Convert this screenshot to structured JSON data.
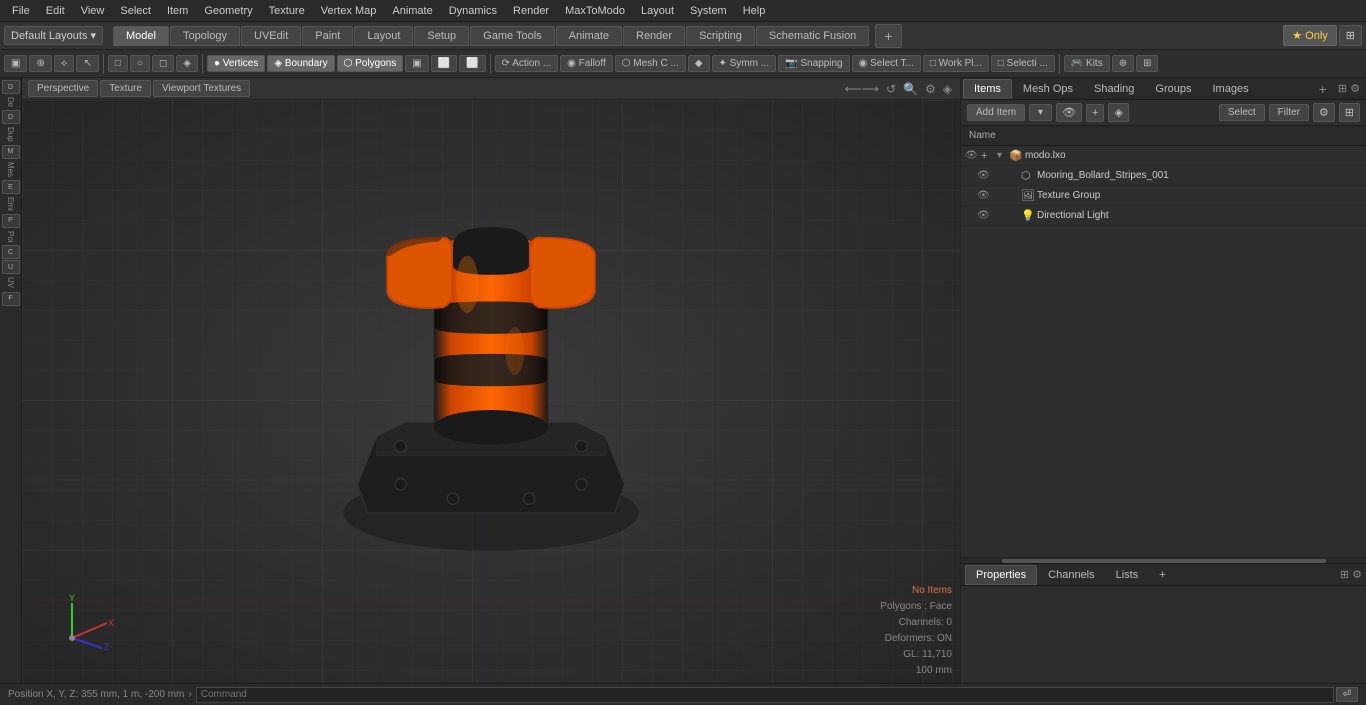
{
  "menubar": {
    "items": [
      "File",
      "Edit",
      "View",
      "Select",
      "Item",
      "Geometry",
      "Texture",
      "Vertex Map",
      "Animate",
      "Dynamics",
      "Render",
      "MaxToModo",
      "Layout",
      "System",
      "Help"
    ]
  },
  "layout_bar": {
    "default_layout": "Default Layouts ▾",
    "tabs": [
      "Model",
      "Topology",
      "UVEdit",
      "Paint",
      "Layout",
      "Setup",
      "Game Tools",
      "Animate",
      "Render",
      "Scripting",
      "Schematic Fusion"
    ],
    "active_tab": "Model",
    "plus": "+",
    "star_label": "★ Only",
    "expand_label": "⊞"
  },
  "toolbar": {
    "items": [
      "▣",
      "⊕",
      "⟡",
      "↖",
      "□",
      "○",
      "◻",
      "◈",
      "● Vertices",
      "◈ Boundary",
      "⬡ Polygons",
      "▣",
      "⬜",
      "⬜",
      "⟳ Action ...",
      "◉ Falloff",
      "⬡ Mesh C ...",
      "◆",
      "✦ Symm ...",
      "📷 Snapping",
      "◉ Select T...",
      "□ Work Pl...",
      "□ Selecti ...",
      "🎮 Kits",
      "⊕",
      "⊞"
    ]
  },
  "viewport": {
    "tabs": [
      "Perspective",
      "Texture",
      "Viewport Textures"
    ],
    "active_tab": "Perspective",
    "status": {
      "no_items": "No Items",
      "polygons": "Polygons : Face",
      "channels": "Channels: 0",
      "deformers": "Deformers: ON",
      "gl": "GL: 11,710",
      "units": "100 mm"
    }
  },
  "position_bar": {
    "text": "Position X, Y, Z:   355 mm, 1 m, -200 mm"
  },
  "right_panel": {
    "tabs": [
      "Items",
      "Mesh Ops",
      "Shading",
      "Groups",
      "Images"
    ],
    "active_tab": "Items",
    "add_item_label": "Add Item",
    "add_item_dropdown": "▾",
    "filter_label": "Filter",
    "select_label": "Select",
    "col_header": "Name",
    "items_list": [
      {
        "id": 0,
        "label": "modo.lxo",
        "icon": "📦",
        "indent": 0,
        "expanded": true,
        "eye": true
      },
      {
        "id": 1,
        "label": "Mooring_Bollard_Stripes_001",
        "icon": "⬡",
        "indent": 1,
        "eye": true
      },
      {
        "id": 2,
        "label": "Texture Group",
        "icon": "🖼",
        "indent": 1,
        "eye": true
      },
      {
        "id": 3,
        "label": "Directional Light",
        "icon": "💡",
        "indent": 1,
        "eye": true
      }
    ]
  },
  "prop_panel": {
    "tabs": [
      "Properties",
      "Channels",
      "Lists"
    ],
    "active_tab": "Properties",
    "plus": "+"
  },
  "command_bar": {
    "placeholder": "Command"
  }
}
